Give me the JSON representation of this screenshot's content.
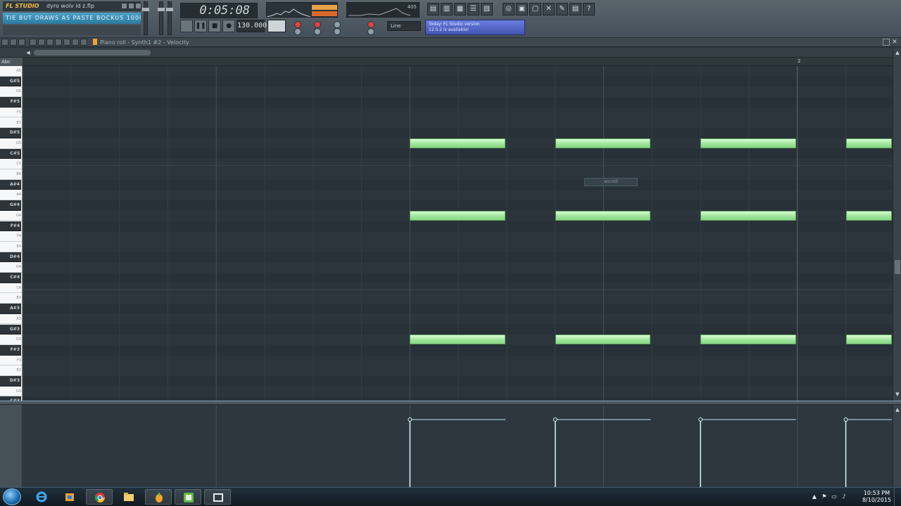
{
  "app": {
    "logo": "FL STUDIO",
    "project_file": "dyro wolv id z.flp",
    "hint_text": "TIE BUT DRAWS AS PASTE BOCKUS 1000 LEN",
    "time_display": "0:05:08",
    "tempo": "130.000",
    "cpu_label": "405",
    "snap_value": "Line",
    "news": [
      "Today: FL Studio version",
      "12.0.2 is available!"
    ]
  },
  "piano_roll": {
    "title": "Piano roll - Synth1 #2 - Velocity",
    "bar_marker": "2",
    "corner_label": "Abc",
    "tooltip": "ancroll",
    "keys": [
      {
        "label": "A5",
        "black": false
      },
      {
        "label": "G#5",
        "black": true
      },
      {
        "label": "G5",
        "black": false
      },
      {
        "label": "F#5",
        "black": true
      },
      {
        "label": "F5",
        "black": false
      },
      {
        "label": "E5",
        "black": false
      },
      {
        "label": "D#5",
        "black": true
      },
      {
        "label": "D5",
        "black": false
      },
      {
        "label": "C#5",
        "black": true
      },
      {
        "label": "C5",
        "black": false
      },
      {
        "label": "B4",
        "black": false
      },
      {
        "label": "A#4",
        "black": true
      },
      {
        "label": "A4",
        "black": false
      },
      {
        "label": "G#4",
        "black": true
      },
      {
        "label": "G4",
        "black": false
      },
      {
        "label": "F#4",
        "black": true
      },
      {
        "label": "F4",
        "black": false
      },
      {
        "label": "E4",
        "black": false
      },
      {
        "label": "D#4",
        "black": true
      },
      {
        "label": "D4",
        "black": false
      },
      {
        "label": "C#4",
        "black": true
      },
      {
        "label": "C4",
        "black": false
      },
      {
        "label": "B3",
        "black": false
      },
      {
        "label": "A#3",
        "black": true
      },
      {
        "label": "A3",
        "black": false
      },
      {
        "label": "G#3",
        "black": true
      },
      {
        "label": "G3",
        "black": false
      },
      {
        "label": "F#3",
        "black": true
      },
      {
        "label": "F3",
        "black": false
      },
      {
        "label": "E3",
        "black": false
      },
      {
        "label": "D#3",
        "black": true
      },
      {
        "label": "D3",
        "black": false
      },
      {
        "label": "C#3",
        "black": true
      }
    ],
    "notes": [
      {
        "pitch": "D5",
        "start_step": 8,
        "length_steps": 2
      },
      {
        "pitch": "D5",
        "start_step": 11,
        "length_steps": 2
      },
      {
        "pitch": "D5",
        "start_step": 14,
        "length_steps": 2
      },
      {
        "pitch": "D5",
        "start_step": 17,
        "length_steps": 2
      },
      {
        "pitch": "G4",
        "start_step": 8,
        "length_steps": 2
      },
      {
        "pitch": "G4",
        "start_step": 11,
        "length_steps": 2
      },
      {
        "pitch": "G4",
        "start_step": 14,
        "length_steps": 2
      },
      {
        "pitch": "G4",
        "start_step": 17,
        "length_steps": 2
      },
      {
        "pitch": "G3",
        "start_step": 8,
        "length_steps": 2
      },
      {
        "pitch": "G3",
        "start_step": 11,
        "length_steps": 2
      },
      {
        "pitch": "G3",
        "start_step": 14,
        "length_steps": 2
      },
      {
        "pitch": "G3",
        "start_step": 17,
        "length_steps": 2
      }
    ],
    "velocities": [
      0.82,
      0.82,
      0.82,
      0.82
    ]
  },
  "taskbar": {
    "clock_time": "10:53 PM",
    "clock_date": "8/10/2015",
    "apps": [
      "start",
      "internet-explorer",
      "windows-store",
      "chrome",
      "file-explorer",
      "fl-studio",
      "camtasia",
      "camtasia-recorder"
    ]
  },
  "colors": {
    "note_fill": "#a7e8a2",
    "grid_bg": "#2b353b",
    "velocity_line": "#d8f2ff",
    "hint_bar": "#3a8db5"
  }
}
